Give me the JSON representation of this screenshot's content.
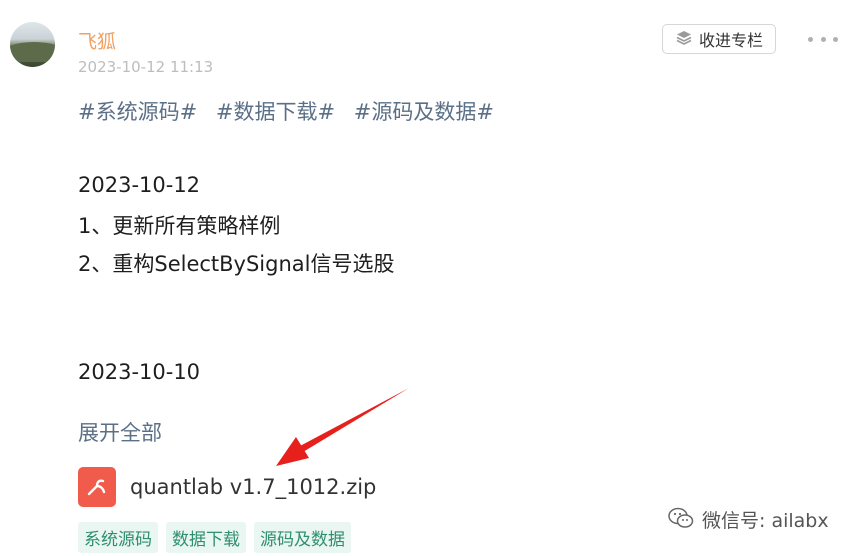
{
  "post": {
    "author": "飞狐",
    "timestamp": "2023-10-12 11:13",
    "collect_label": "收进专栏",
    "hashtags": [
      "#系统源码#",
      "#数据下载#",
      "#源码及数据#"
    ],
    "lines": [
      "2023-10-12",
      "1、更新所有策略样例",
      "2、重构SelectBySignal信号选股",
      "2023-10-10"
    ],
    "expand_label": "展开全部",
    "attachment": {
      "name": "quantlab v1.7_1012.zip",
      "icon": "pdf-file-icon",
      "color": "#f15b4c"
    },
    "tags": [
      "系统源码",
      "数据下载",
      "源码及数据"
    ]
  },
  "watermark": {
    "text": "微信号: ailabx",
    "icon": "wechat-icon"
  },
  "colors": {
    "author": "#f0a060",
    "link": "#5b7087",
    "tag_text": "#2f8f6e",
    "tag_bg": "#eaf6f1",
    "arrow": "#e8201c"
  }
}
